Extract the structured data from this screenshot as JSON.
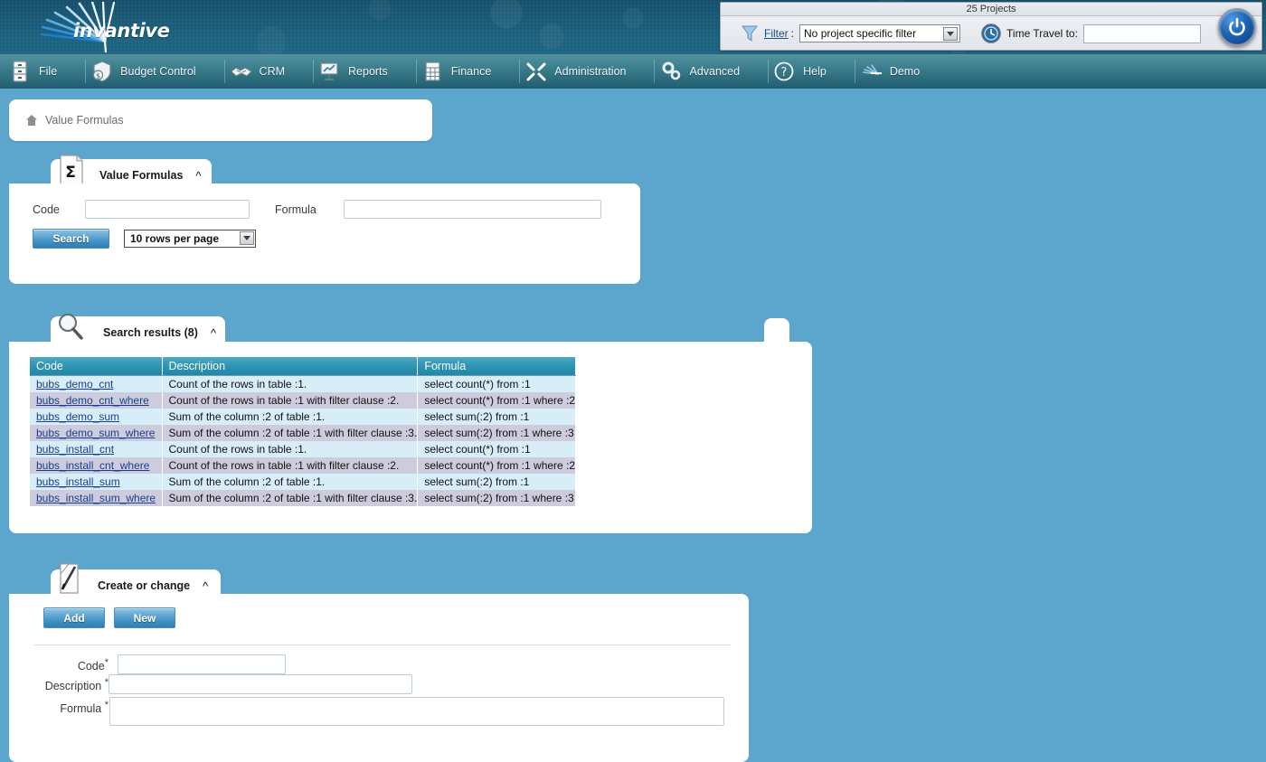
{
  "app": {
    "logo_text": "invantive",
    "logo_icon": "burst-rays-logo"
  },
  "topbar": {
    "projects_label": "25 Projects",
    "filter_icon": "funnel-icon",
    "filter_link": "Filter",
    "filter_colon": ":",
    "filter_value": "No project specific filter",
    "time_travel_icon": "clock-globe-icon",
    "time_travel_label": "Time Travel to:",
    "time_travel_value": "",
    "power_icon": "power-icon"
  },
  "menu": [
    {
      "label": "File",
      "icon": "file-cabinet-icon"
    },
    {
      "label": "Budget Control",
      "icon": "shield-dollar-icon"
    },
    {
      "label": "CRM",
      "icon": "handshake-icon"
    },
    {
      "label": "Reports",
      "icon": "presentation-chart-icon"
    },
    {
      "label": "Finance",
      "icon": "calculator-icon"
    },
    {
      "label": "Administration",
      "icon": "tools-icon"
    },
    {
      "label": "Advanced",
      "icon": "gears-icon"
    },
    {
      "label": "Help",
      "icon": "question-circle-icon"
    },
    {
      "label": "Demo",
      "icon": "invantive-small-icon"
    }
  ],
  "breadcrumb": {
    "home_icon": "home-icon",
    "text": "Value Formulas"
  },
  "search_panel": {
    "icon": "sigma-document-icon",
    "title": "Value Formulas",
    "collapse_icon": "chevron-up-icon",
    "code_label": "Code",
    "code_value": "",
    "formula_label": "Formula",
    "formula_value": "",
    "search_button": "Search",
    "rows_per_page": "10 rows per page"
  },
  "results_panel": {
    "icon": "magnifier-icon",
    "title": "Search results (8)",
    "collapse_icon": "chevron-up-icon",
    "columns": [
      "Code",
      "Description",
      "Formula"
    ],
    "rows": [
      {
        "code": "bubs_demo_cnt",
        "description": "Count of the rows in table :1.",
        "formula": "select count(*) from :1"
      },
      {
        "code": "bubs_demo_cnt_where",
        "description": "Count of the rows in table :1 with filter clause :2.",
        "formula": "select count(*) from :1 where :2"
      },
      {
        "code": "bubs_demo_sum",
        "description": "Sum of the column :2 of table :1.",
        "formula": "select sum(:2) from :1"
      },
      {
        "code": "bubs_demo_sum_where",
        "description": "Sum of the column :2 of table :1 with filter clause :3.",
        "formula": "select sum(:2) from :1 where :3"
      },
      {
        "code": "bubs_install_cnt",
        "description": "Count of the rows in table :1.",
        "formula": "select count(*) from :1"
      },
      {
        "code": "bubs_install_cnt_where",
        "description": "Count of the rows in table :1 with filter clause :2.",
        "formula": "select count(*) from :1 where :2"
      },
      {
        "code": "bubs_install_sum",
        "description": "Sum of the column :2 of table :1.",
        "formula": "select sum(:2) from :1"
      },
      {
        "code": "bubs_install_sum_where",
        "description": "Sum of the column :2 of table :1 with filter clause :3.",
        "formula": "select sum(:2) from :1 where :3"
      }
    ]
  },
  "edit_panel": {
    "icon": "pen-paper-icon",
    "title": "Create or change",
    "collapse_icon": "chevron-up-icon",
    "add_button": "Add",
    "new_button": "New",
    "code_label": "Code",
    "code_value": "",
    "description_label": "Description",
    "description_value": "",
    "formula_label": "Formula",
    "formula_value": "",
    "required_mark": "*"
  },
  "colors": {
    "page_bg": "#5ca6cd",
    "banner": "#1b5d79",
    "menubar": "#2e6d7e",
    "table_header": "#2e94b4",
    "row_odd": "#d7edf8",
    "row_even": "#ccccdd",
    "link": "#1b3f8f",
    "button": "#3e8fc2"
  }
}
